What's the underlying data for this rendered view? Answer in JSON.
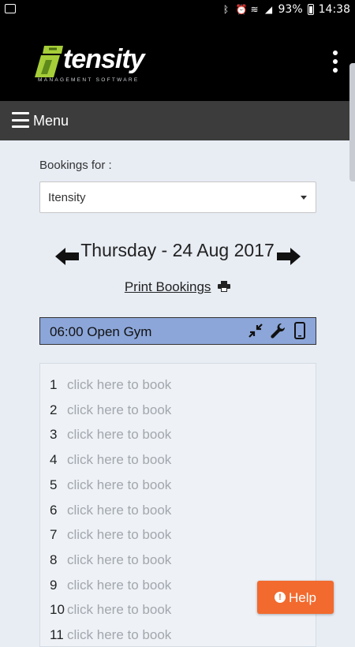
{
  "status_bar": {
    "battery": "93%",
    "time": "14:38"
  },
  "header": {
    "logo_word": "tensity",
    "logo_subtitle": "MANAGEMENT SOFTWARE"
  },
  "menu": {
    "label": "Menu"
  },
  "bookings": {
    "label": "Bookings for :",
    "selected": "Itensity",
    "date": "Thursday - 24 Aug 2017",
    "print_label": "Print Bookings"
  },
  "session": {
    "title": "06:00 Open Gym"
  },
  "slots": [
    {
      "num": "1",
      "text": "click here to book"
    },
    {
      "num": "2",
      "text": "click here to book"
    },
    {
      "num": "3",
      "text": "click here to book"
    },
    {
      "num": "4",
      "text": "click here to book"
    },
    {
      "num": "5",
      "text": "click here to book"
    },
    {
      "num": "6",
      "text": "click here to book"
    },
    {
      "num": "7",
      "text": "click here to book"
    },
    {
      "num": "8",
      "text": "click here to book"
    },
    {
      "num": "9",
      "text": "click here to book"
    },
    {
      "num": "10",
      "text": "click here to book"
    },
    {
      "num": "11",
      "text": "click here to book"
    }
  ],
  "help": {
    "label": "Help"
  },
  "colors": {
    "header_bg": "#000000",
    "menu_bg": "#3c3c3c",
    "session_bg": "#8ca6d9",
    "help_bg": "#f26a2e",
    "logo_accent": "#a6ce39"
  }
}
